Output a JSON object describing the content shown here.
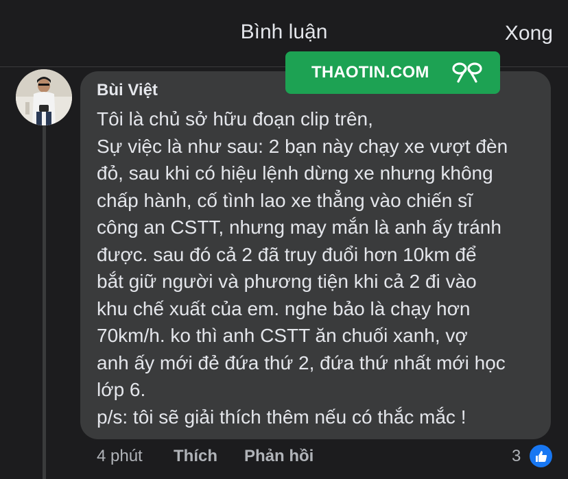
{
  "header": {
    "title": "Bình luận",
    "done_label": "Xong"
  },
  "watermark": {
    "text": "THAOTIN.COM",
    "icon": "ribbon-icon"
  },
  "comment": {
    "author": "Bùi Việt",
    "lines": [
      "Tôi là chủ sở hữu đoạn clip trên,",
      "Sự việc là như sau: 2 bạn này chạy xe vượt đèn",
      "đỏ, sau khi có hiệu lệnh dừng xe nhưng không",
      "chấp hành, cố tình lao xe thẳng vào chiến sĩ",
      "công an CSTT, nhưng may mắn là anh ấy tránh",
      "được. sau đó cả 2 đã truy đuổi hơn 10km để",
      "bắt giữ người và phương tiện khi cả 2 đi vào",
      "khu chế xuất của em. nghe bảo là chạy hơn",
      "70km/h. ko thì anh CSTT ăn chuối xanh, vợ",
      "anh ấy mới đẻ đứa thứ 2, đứa thứ nhất mới học",
      "lớp 6.",
      "p/s: tôi sẽ giải thích thêm nếu có thắc mắc !"
    ],
    "time": "4 phút",
    "like_label": "Thích",
    "reply_label": "Phản hồi",
    "reaction_count": "3",
    "reaction_icon": "thumbs-up-icon"
  },
  "colors": {
    "background": "#1c1c1e",
    "bubble": "#3a3b3c",
    "watermark_green": "#1da253",
    "like_blue": "#1877f2"
  }
}
